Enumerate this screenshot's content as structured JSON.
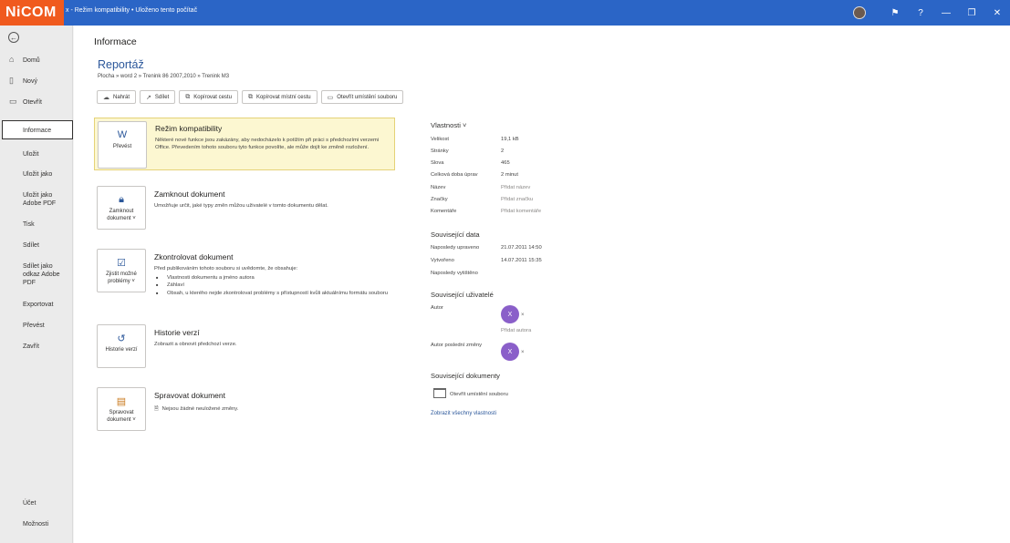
{
  "titlebar": {
    "logo": "NiCOM",
    "title": "x - Režim kompatibility • Uloženo tento počítač",
    "buttons": [
      "⚑",
      "?",
      "—",
      "❐",
      "✕"
    ]
  },
  "sidebar": {
    "items": [
      {
        "label": "Domů",
        "icon": "⌂"
      },
      {
        "label": "Nový",
        "icon": "▯"
      },
      {
        "label": "Otevřít",
        "icon": "▭"
      },
      {
        "label": "Informace"
      },
      {
        "label": "Uložit"
      },
      {
        "label": "Uložit jako"
      },
      {
        "label": "Uložit jako Adobe PDF"
      },
      {
        "label": "Tisk"
      },
      {
        "label": "Sdílet"
      },
      {
        "label": "Sdílet jako odkaz Adobe PDF"
      },
      {
        "label": "Exportovat"
      },
      {
        "label": "Převést"
      },
      {
        "label": "Zavřít"
      },
      {
        "label": "Účet"
      },
      {
        "label": "Možnosti"
      }
    ]
  },
  "main": {
    "page_title": "Informace",
    "doc_title": "Reportáž",
    "doc_path": "Plocha » word 2 » Trenink 86 2007,2010 » Trenink M3",
    "actions": [
      {
        "label": "Nahrát",
        "icon": "☁"
      },
      {
        "label": "Sdílet",
        "icon": "↗"
      },
      {
        "label": "Kopírovat cestu",
        "icon": "⧉"
      },
      {
        "label": "Kopírovat místní cestu",
        "icon": "⧉"
      },
      {
        "label": "Otevřít umístění souboru",
        "icon": "▭"
      }
    ],
    "sections": {
      "compat": {
        "card": "Převést",
        "title": "Režim kompatibility",
        "desc": "Některé nové funkce jsou zakázány, aby nedocházelo k potížím při práci s předchozími verzemi Office. Převedením tohoto souboru tyto funkce povolíte, ale může dojít ke změně rozložení."
      },
      "protect": {
        "card": "Zamknout dokument ˅",
        "title": "Zamknout dokument",
        "desc": "Umožňuje určit, jaké typy změn můžou uživatelé v tomto dokumentu dělat."
      },
      "inspect": {
        "card": "Zjistit možné problémy ˅",
        "title": "Zkontrolovat dokument",
        "desc": "Před publikováním tohoto souboru si uvědomte, že obsahuje:",
        "items": [
          "Vlastnosti dokumentu a jméno autora",
          "Záhlaví",
          "Obsah, u kterého nejde zkontrolovat problémy s přístupností kvůli aktuálnímu formátu souboru"
        ]
      },
      "versions": {
        "card": "Historie verzí",
        "title": "Historie verzí",
        "desc": "Zobrazit a obnovit předchozí verze."
      },
      "manage": {
        "card": "Spravovat dokument ˅",
        "title": "Spravovat dokument",
        "desc": "Nejsou žádné neuložené změny."
      }
    }
  },
  "properties": {
    "header": "Vlastnosti ˅",
    "rows": [
      {
        "k": "Velikost",
        "v": "19,1 kB"
      },
      {
        "k": "Stránky",
        "v": "2"
      },
      {
        "k": "Slova",
        "v": "465"
      },
      {
        "k": "Celková doba úprav",
        "v": "2 minut"
      },
      {
        "k": "Název",
        "v": "Přidat název"
      },
      {
        "k": "Značky",
        "v": "Přidat značku"
      },
      {
        "k": "Komentáře",
        "v": "Přidat komentáře"
      }
    ],
    "dates_header": "Související data",
    "dates": [
      {
        "k": "Naposledy upraveno",
        "v": "21.07.2011 14:50"
      },
      {
        "k": "Vytvořeno",
        "v": "14.07.2011 15:35"
      },
      {
        "k": "Naposledy vytištěno",
        "v": ""
      }
    ],
    "people_header": "Související uživatelé",
    "author_label": "Autor",
    "author_initial": "X",
    "add_author": "Přidat autora",
    "last_modified_label": "Autor poslední změny",
    "last_initial": "X",
    "docs_header": "Související dokumenty",
    "open_location": "Otevřít umístění souboru",
    "show_all": "Zobrazit všechny vlastnosti"
  }
}
